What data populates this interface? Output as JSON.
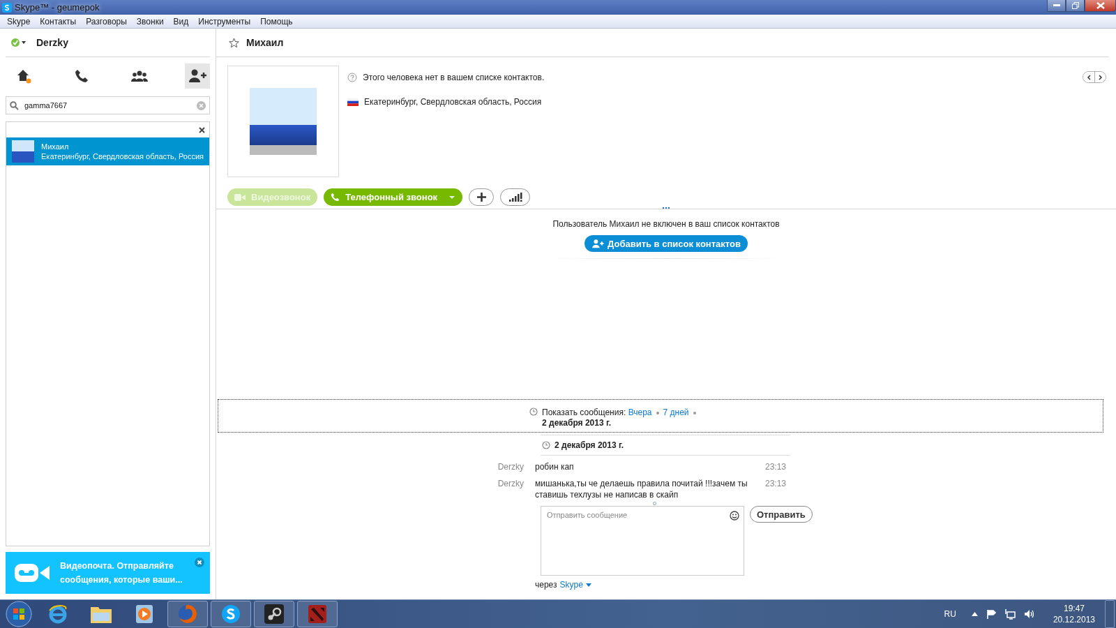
{
  "window": {
    "title": "Skype™ - geumepok"
  },
  "menu": [
    "Skype",
    "Контакты",
    "Разговоры",
    "Звонки",
    "Вид",
    "Инструменты",
    "Помощь"
  ],
  "sidebar": {
    "user": "Derzky",
    "nav": [
      {
        "kind": "home",
        "selected": false
      },
      {
        "kind": "calls",
        "selected": false
      },
      {
        "kind": "groups",
        "selected": false
      },
      {
        "kind": "add-contact",
        "selected": true
      }
    ],
    "search": {
      "value": "gamma7667"
    },
    "results": [
      {
        "name": "Михаил",
        "location": "Екатеринбург, Свердловская область, Россия",
        "selected": true
      }
    ],
    "promo": {
      "text": "Видеопочта. Отправляйте сообщения, которые ваши..."
    }
  },
  "contact": {
    "name": "Михаил",
    "notice": "Этого человека нет в вашем списке контактов.",
    "location": "Екатеринбург, Свердловская область, Россия",
    "buttons": [
      {
        "kind": "video",
        "label": "Видеозвонок",
        "disabled": true
      },
      {
        "kind": "phone",
        "label": "Телефонный звонок",
        "disabled": false
      }
    ]
  },
  "banner": {
    "text": "Пользователь Михаил не включен в ваш список контактов",
    "button": "Добавить в список контактов"
  },
  "history": {
    "label": "Показать сообщения:",
    "options": [
      {
        "label": "Вчера",
        "selected": false
      },
      {
        "label": "7 дней",
        "selected": false
      },
      {
        "label": "2 декабря 2013 г.",
        "selected": true
      }
    ]
  },
  "conversation": {
    "date": "2 декабря 2013 г.",
    "messages": [
      {
        "sender": "Derzky",
        "text": "робин кап",
        "time": "23:13"
      },
      {
        "sender": "Derzky",
        "text": "мишанька,ты че делаешь правила почитай !!!зачем ты ставишь техлузы не написав в скайп",
        "time": "23:13"
      }
    ]
  },
  "composer": {
    "placeholder": "Отправить сообщение",
    "send": "Отправить",
    "via_label": "через",
    "via": "Skype"
  },
  "taskbar": {
    "apps": [
      {
        "kind": "ie",
        "running": false
      },
      {
        "kind": "folder",
        "running": false
      },
      {
        "kind": "media",
        "running": false
      },
      {
        "kind": "firefox",
        "running": true
      },
      {
        "kind": "skype",
        "running": true
      },
      {
        "kind": "steam",
        "running": true
      },
      {
        "kind": "game",
        "running": true
      }
    ],
    "language": "RU",
    "time": "19:47",
    "date": "20.12.2013"
  }
}
